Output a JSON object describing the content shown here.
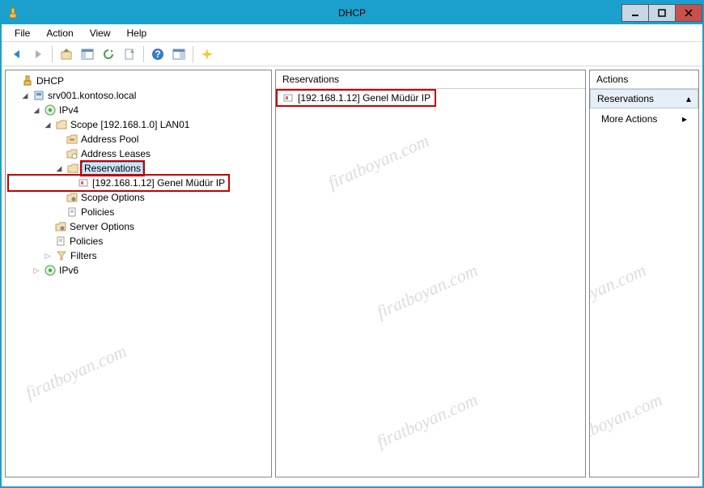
{
  "window": {
    "title": "DHCP"
  },
  "menu": {
    "file": "File",
    "action": "Action",
    "view": "View",
    "help": "Help"
  },
  "tree": {
    "root": "DHCP",
    "server": "srv001.kontoso.local",
    "ipv4": "IPv4",
    "scope": "Scope [192.168.1.0] LAN01",
    "address_pool": "Address Pool",
    "address_leases": "Address Leases",
    "reservations_node": "Reservations",
    "reservation_item": "[192.168.1.12] Genel Müdür IP",
    "scope_options": "Scope Options",
    "scope_policies": "Policies",
    "server_options": "Server Options",
    "server_policies": "Policies",
    "filters": "Filters",
    "ipv6": "IPv6"
  },
  "list": {
    "header": "Reservations",
    "item": "[192.168.1.12] Genel Müdür IP"
  },
  "actions": {
    "header": "Actions",
    "sub": "Reservations",
    "more": "More Actions"
  },
  "watermark": "firatboyan.com"
}
